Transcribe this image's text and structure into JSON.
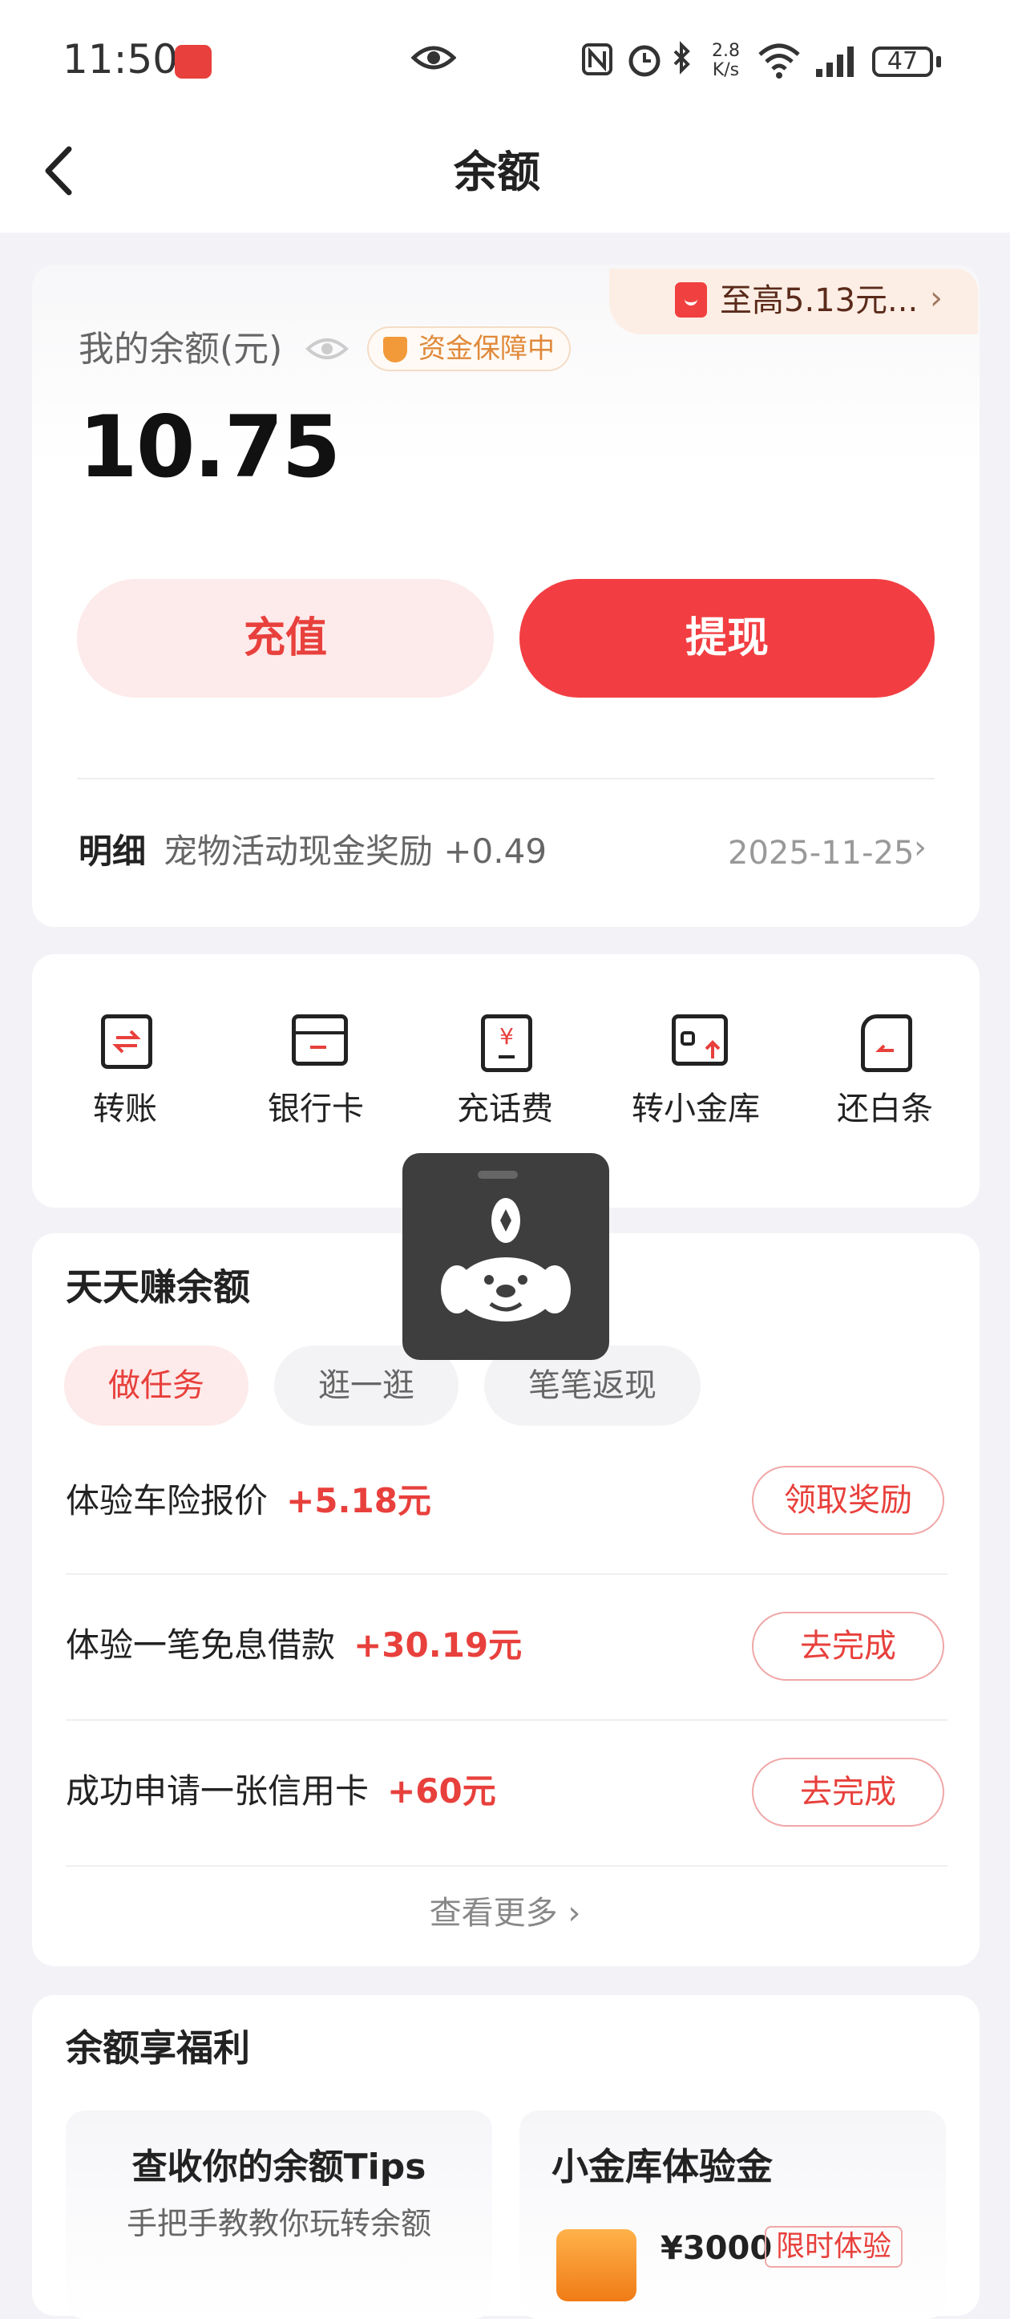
{
  "status_bar": {
    "time": "11:50",
    "net_speed_value": "2.8",
    "net_speed_unit": "K/s",
    "battery": "47"
  },
  "nav": {
    "title": "余额"
  },
  "balance": {
    "promo_text": "至高5.13元...",
    "label": "我的余额(元)",
    "guarantee": "资金保障中",
    "amount": "10.75",
    "recharge_label": "充值",
    "withdraw_label": "提现",
    "detail_label": "明细",
    "detail_text": "宠物活动现金奖励 +0.49",
    "detail_date": "2025-11-25"
  },
  "quick_actions": [
    {
      "label": "转账",
      "icon": "transfer-icon"
    },
    {
      "label": "银行卡",
      "icon": "bank-card-icon"
    },
    {
      "label": "充话费",
      "icon": "phone-bill-icon"
    },
    {
      "label": "转小金库",
      "icon": "vault-transfer-icon"
    },
    {
      "label": "还白条",
      "icon": "repay-icon"
    }
  ],
  "earn": {
    "title": "天天赚余额",
    "chips": [
      "做任务",
      "逛一逛",
      "笔笔返现"
    ],
    "active_chip": 0,
    "tasks": [
      {
        "title": "体验车险报价",
        "reward": "+5.18元",
        "button": "领取奖励"
      },
      {
        "title": "体验一笔免息借款",
        "reward": "+30.19元",
        "button": "去完成"
      },
      {
        "title": "成功申请一张信用卡",
        "reward": "+60元",
        "button": "去完成"
      }
    ],
    "more_label": "查看更多 ›"
  },
  "welfare": {
    "title": "余额享福利",
    "card1_title": "查收你的余额Tips",
    "card1_sub": "手把手教教你玩转余额",
    "card2_title": "小金库体验金",
    "card2_amount": "¥3000",
    "card2_tag": "限时体验"
  },
  "colors": {
    "accent": "#f23e42",
    "accent_light": "#fdeaea",
    "guard": "#e0893a",
    "promo_bg": "#fdeee5"
  }
}
